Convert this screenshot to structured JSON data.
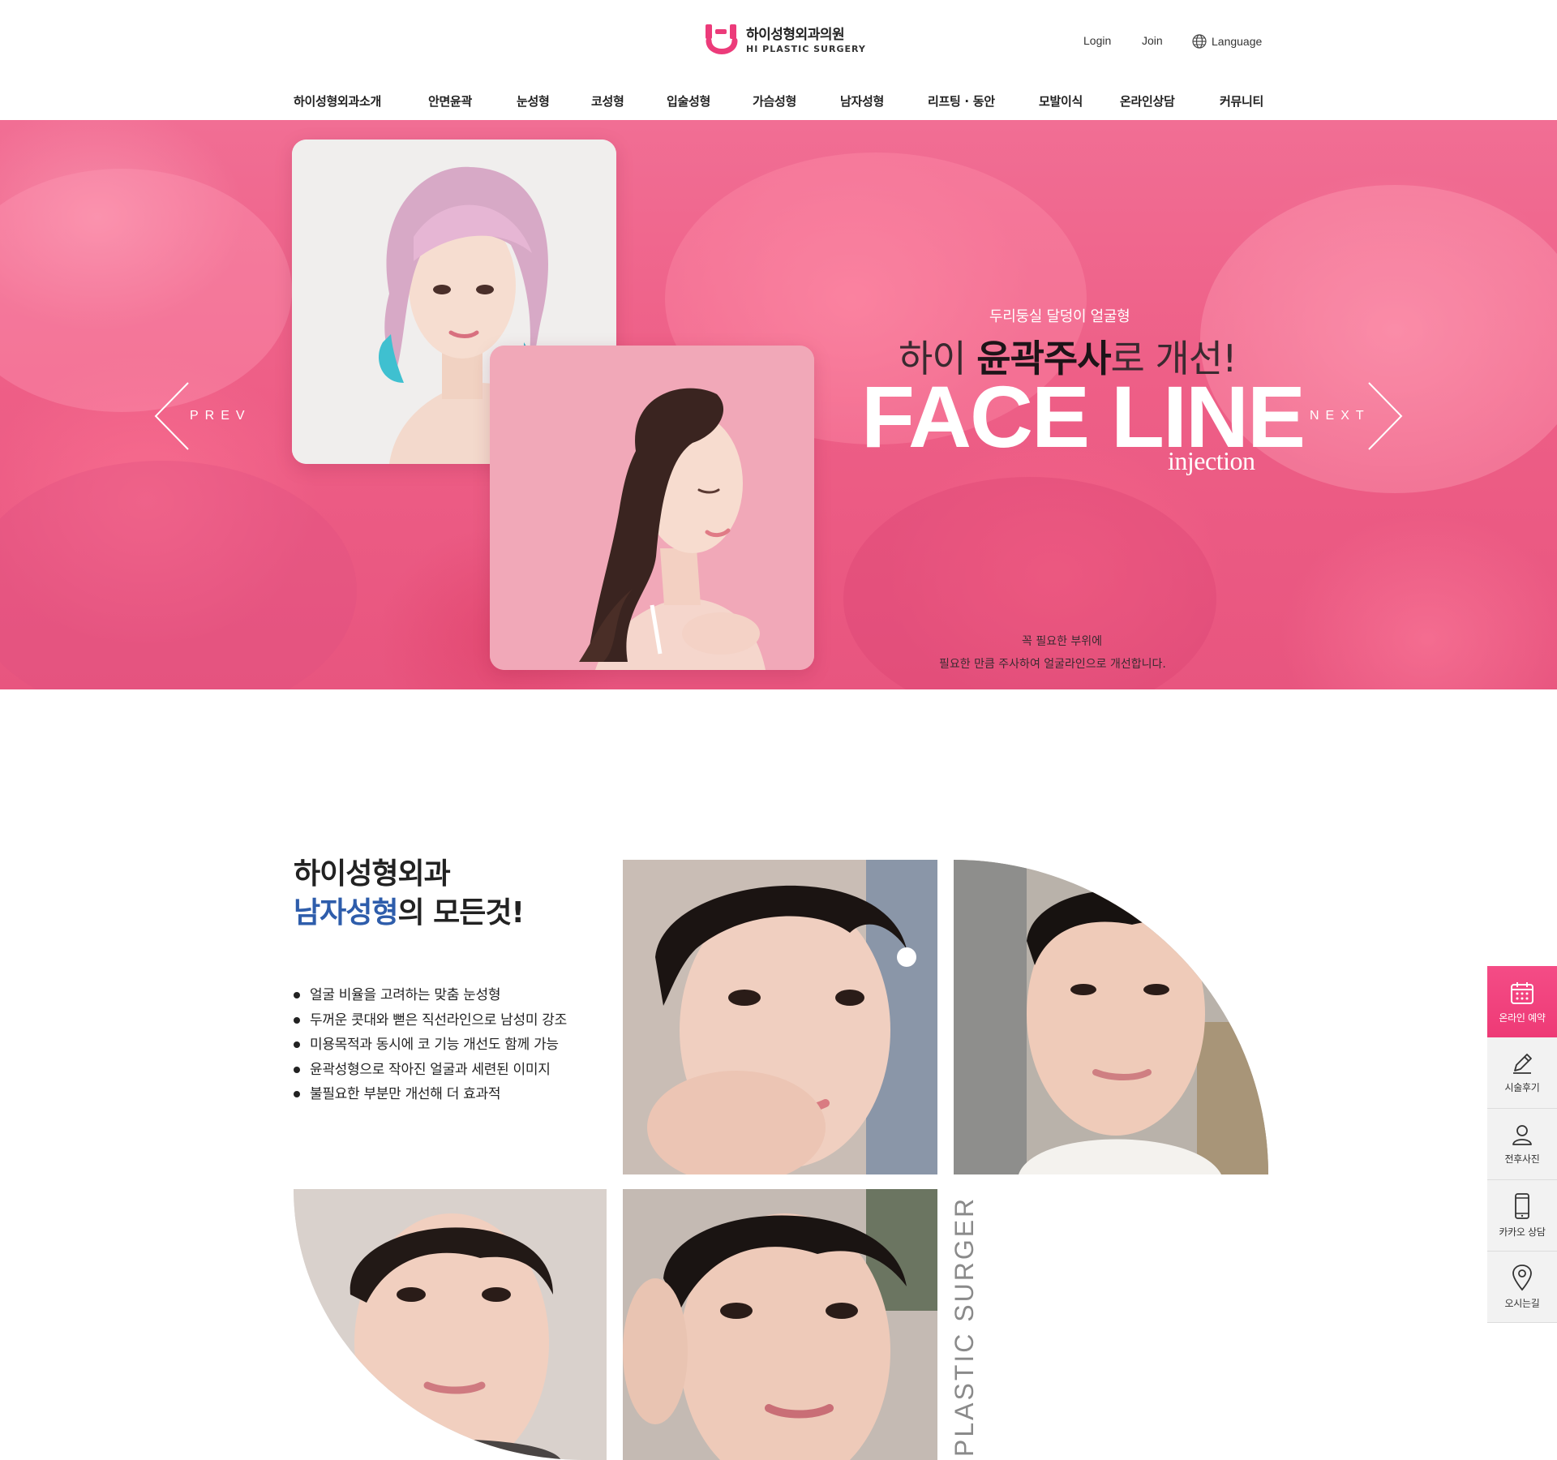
{
  "header": {
    "logo_ko": "하이성형외과의원",
    "logo_en": "HI PLASTIC SURGERY",
    "login": "Login",
    "join": "Join",
    "language": "Language",
    "nav": [
      "하이성형외과소개",
      "안면윤곽",
      "눈성형",
      "코성형",
      "입술성형",
      "가슴성형",
      "남자성형",
      "리프팅 · 동안",
      "모발이식",
      "온라인상담",
      "커뮤니티"
    ]
  },
  "hero": {
    "sub": "두리둥실 달덩이 얼굴형",
    "line2_pre": "하이 ",
    "line2_bold": "윤곽주사",
    "line2_post": "로 개선!",
    "title": "FACE LINE",
    "title_sub": "injection",
    "desc1": "꼭 필요한 부위에",
    "desc2": "필요한 만큼 주사하여 얼굴라인으로 개선합니다.",
    "prev": "PREV",
    "next": "NEXT"
  },
  "men": {
    "title_line1": "하이성형외과",
    "title_accent": "남자성형",
    "title_rest": "의 모든것!",
    "bullets": [
      "얼굴 비율을 고려하는 맞춤 눈성형",
      "두꺼운 콧대와 뻗은 직선라인으로 남성미 강조",
      "미용목적과 동시에 코 기능 개선도 함께 가능",
      "윤곽성형으로 작아진 얼굴과 세련된 이미지",
      "불필요한 부분만 개선해 더 효과적"
    ],
    "vertical_text": "PLASTIC SURGERY"
  },
  "quick_menu": [
    {
      "label": "온라인 예약",
      "icon": "calendar-icon"
    },
    {
      "label": "시술후기",
      "icon": "pencil-icon"
    },
    {
      "label": "전후사진",
      "icon": "user-icon"
    },
    {
      "label": "카카오 상담",
      "icon": "smartphone-icon"
    },
    {
      "label": "오시는길",
      "icon": "map-pin-icon"
    }
  ],
  "colors": {
    "brand_pink": "#ee3a76",
    "hero_pink": "#ee5f87",
    "accent_blue": "#2e5dab"
  }
}
